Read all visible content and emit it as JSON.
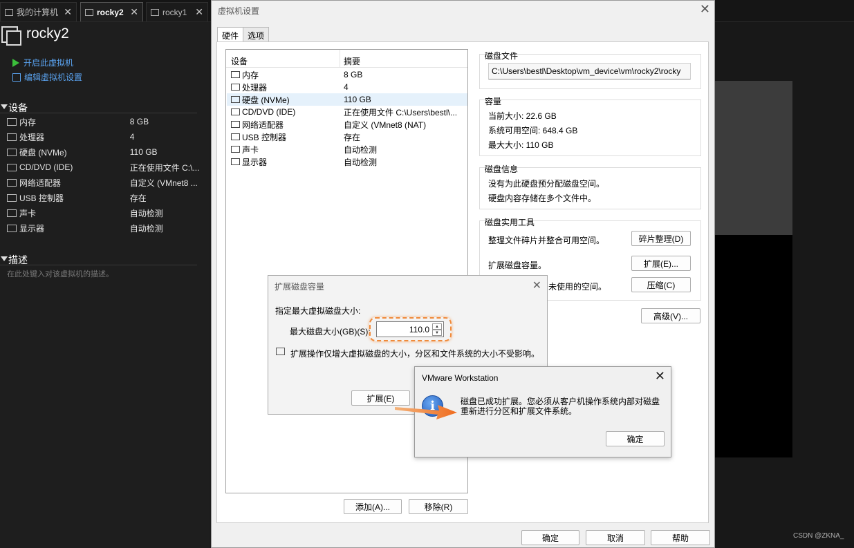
{
  "tabs": [
    {
      "label": "我的计算机",
      "active": false
    },
    {
      "label": "rocky2",
      "active": true
    },
    {
      "label": "rocky1",
      "active": false
    }
  ],
  "vm": {
    "name": "rocky2",
    "actions": {
      "power_on": "开启此虚拟机",
      "edit_settings": "编辑虚拟机设置"
    },
    "devices_title": "设备",
    "devices": [
      {
        "name": "内存",
        "value": "8 GB",
        "icon": "memory-icon"
      },
      {
        "name": "处理器",
        "value": "4",
        "icon": "cpu-icon"
      },
      {
        "name": "硬盘 (NVMe)",
        "value": "110 GB",
        "icon": "disk-icon"
      },
      {
        "name": "CD/DVD (IDE)",
        "value": "正在使用文件 C:\\...",
        "icon": "cd-icon"
      },
      {
        "name": "网络适配器",
        "value": "自定义 (VMnet8 ...",
        "icon": "network-icon"
      },
      {
        "name": "USB 控制器",
        "value": "存在",
        "icon": "usb-icon"
      },
      {
        "name": "声卡",
        "value": "自动检测",
        "icon": "sound-icon"
      },
      {
        "name": "显示器",
        "value": "自动检测",
        "icon": "display-icon"
      }
    ],
    "desc_title": "描述",
    "desc_hint": "在此处键入对该虚拟机的描述。"
  },
  "settings": {
    "title": "虚拟机设置",
    "tab_hardware": "硬件",
    "tab_options": "选项",
    "col_device": "设备",
    "col_summary": "摘要",
    "devices": [
      {
        "name": "内存",
        "value": "8 GB",
        "selected": false
      },
      {
        "name": "处理器",
        "value": "4",
        "selected": false
      },
      {
        "name": "硬盘 (NVMe)",
        "value": "110 GB",
        "selected": true
      },
      {
        "name": "CD/DVD (IDE)",
        "value": "正在使用文件 C:\\Users\\bestl\\...",
        "selected": false
      },
      {
        "name": "网络适配器",
        "value": "自定义 (VMnet8 (NAT)",
        "selected": false
      },
      {
        "name": "USB 控制器",
        "value": "存在",
        "selected": false
      },
      {
        "name": "声卡",
        "value": "自动检测",
        "selected": false
      },
      {
        "name": "显示器",
        "value": "自动检测",
        "selected": false
      }
    ],
    "disk_file_label": "磁盘文件",
    "disk_file": "C:\\Users\\bestl\\Desktop\\vm_device\\vm\\rocky2\\rocky",
    "capacity_label": "容量",
    "current_size": "当前大小: 22.6 GB",
    "free_space": "系统可用空间: 648.4 GB",
    "max_size": "最大大小: 110 GB",
    "disk_info_label": "磁盘信息",
    "info_line1": "没有为此硬盘预分配磁盘空间。",
    "info_line2": "硬盘内容存储在多个文件中。",
    "tools_label": "磁盘实用工具",
    "defrag_text": "整理文件碎片并整合可用空间。",
    "defrag_btn": "碎片整理(D)",
    "expand_text": "扩展磁盘容量。",
    "expand_btn": "扩展(E)...",
    "compact_text": "未使用的空间。",
    "compact_btn": "压缩(C)",
    "advanced_btn": "高级(V)...",
    "add_btn": "添加(A)...",
    "remove_btn": "移除(R)",
    "ok_btn": "确定",
    "cancel_btn": "取消",
    "help_btn": "帮助"
  },
  "expand_dialog": {
    "title": "扩展磁盘容量",
    "prompt": "指定最大虚拟磁盘大小:",
    "size_label": "最大磁盘大小(GB)(S):",
    "size_value": "110.0",
    "note": "扩展操作仅增大虚拟磁盘的大小，分区和文件系统的大小不受影响。",
    "expand_btn": "扩展(E)"
  },
  "message_box": {
    "title": "VMware Workstation",
    "text": "磁盘已成功扩展。您必须从客户机操作系统内部对磁盘重新进行分区和扩展文件系统。",
    "ok_btn": "确定"
  },
  "watermark": "CSDN @ZKNA_",
  "colors": {
    "accent_link": "#5aa3f0",
    "highlight": "#f08a3a",
    "play": "#3bbf3b"
  }
}
